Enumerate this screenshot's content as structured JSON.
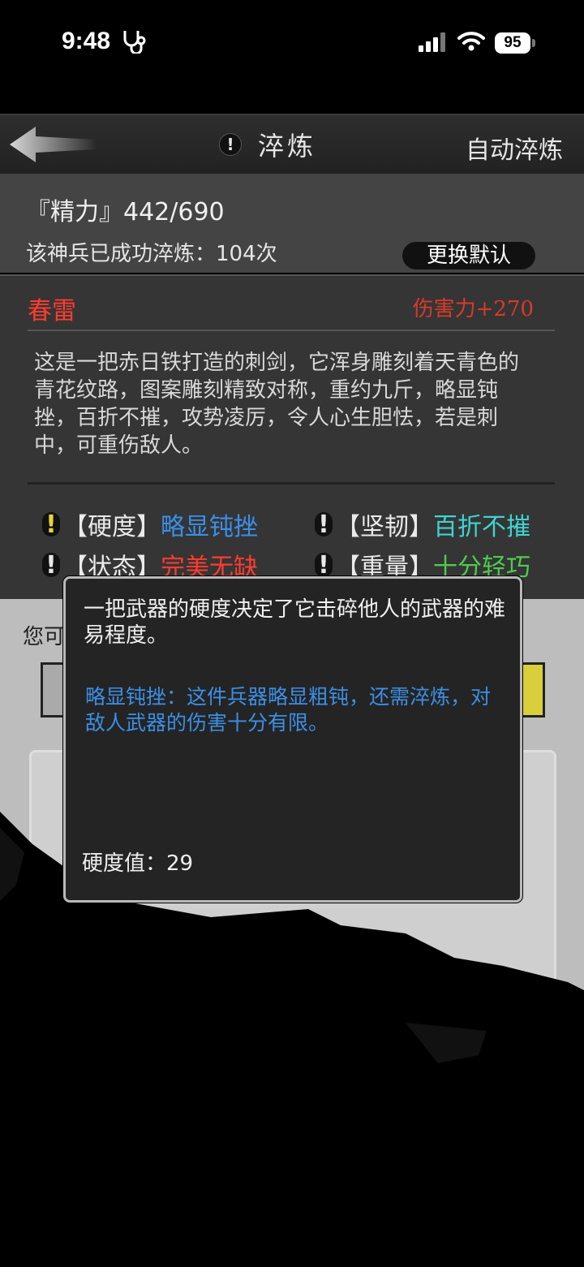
{
  "status_bar": {
    "time": "9:48",
    "battery": "95"
  },
  "header": {
    "title": "淬炼",
    "auto_button": "自动淬炼"
  },
  "energy_panel": {
    "energy_text": "『精力』442/690",
    "success_text": "该神兵已成功淬炼：104次",
    "change_default_button": "更换默认"
  },
  "weapon": {
    "name": "春雷",
    "damage": "伤害力+270",
    "description": "这是一把赤日铁打造的刺剑，它浑身雕刻着天青色的青花纹路，图案雕刻精致对称，重约九斤，略显钝挫，百折不摧，攻势凌厉，令人心生胆怯，若是刺中，可重伤敌人。",
    "attributes": [
      {
        "label": "【硬度】",
        "value": "略显钝挫",
        "color": "#3a8fe8",
        "icon_color": "#e8d23a"
      },
      {
        "label": "【坚韧】",
        "value": "百折不摧",
        "color": "#3fd4d0",
        "icon_color": "#e6e6e6"
      },
      {
        "label": "【状态】",
        "value": "完美无缺",
        "color": "#ff3b2f",
        "icon_color": "#e6e6e6"
      },
      {
        "label": "【重量】",
        "value": "十分轻巧",
        "color": "#4ecb4e",
        "icon_color": "#e6e6e6"
      }
    ]
  },
  "below": {
    "hint_text": "您可"
  },
  "tooltip": {
    "description": "一把武器的硬度决定了它击碎他人的武器的难易程度。",
    "level_text": "略显钝挫：这件兵器略显粗钝，还需淬炼，对敌人武器的伤害十分有限。",
    "value_text": "硬度值：29"
  }
}
